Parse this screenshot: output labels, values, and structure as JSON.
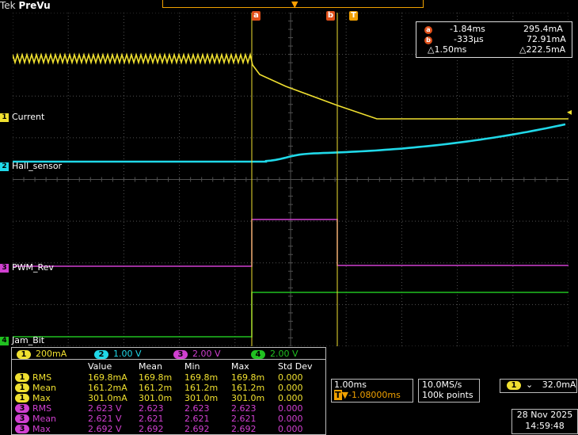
{
  "brand": {
    "tek": "Tek",
    "mode": "PreVu"
  },
  "colors": {
    "ch1": "#f0e030",
    "ch2": "#20d8e8",
    "ch3": "#d040d0",
    "ch4": "#20c020",
    "cursor": "#e0501a",
    "trigger": "#f0a000",
    "grid": "#505050"
  },
  "channels": [
    {
      "num": "1",
      "name": "Current"
    },
    {
      "num": "2",
      "name": "Hall_sensor"
    },
    {
      "num": "3",
      "name": "PWM_Rev"
    },
    {
      "num": "4",
      "name": "Jam_Bit"
    }
  ],
  "cursor_markers": {
    "a": "a",
    "b": "b",
    "t": "T"
  },
  "cursor_readout": {
    "a_time": "-1.84ms",
    "a_value": "295.4mA",
    "b_time": "-333µs",
    "b_value": "72.91mA",
    "delta_time": "△1.50ms",
    "delta_value": "△222.5mA"
  },
  "channel_scales": [
    {
      "num": "1",
      "scale": "200mA"
    },
    {
      "num": "2",
      "scale": "1.00 V"
    },
    {
      "num": "3",
      "scale": "2.00 V"
    },
    {
      "num": "4",
      "scale": "2.00 V"
    }
  ],
  "measurements": {
    "headers": [
      "Value",
      "Mean",
      "Min",
      "Max",
      "Std Dev"
    ],
    "rows": [
      {
        "ch": "1",
        "label": "RMS",
        "values": [
          "169.8mA",
          "169.8m",
          "169.8m",
          "169.8m",
          "0.000"
        ]
      },
      {
        "ch": "1",
        "label": "Mean",
        "values": [
          "161.2mA",
          "161.2m",
          "161.2m",
          "161.2m",
          "0.000"
        ]
      },
      {
        "ch": "1",
        "label": "Max",
        "values": [
          "301.0mA",
          "301.0m",
          "301.0m",
          "301.0m",
          "0.000"
        ]
      },
      {
        "ch": "3",
        "label": "RMS",
        "values": [
          "2.623 V",
          "2.623",
          "2.623",
          "2.623",
          "0.000"
        ]
      },
      {
        "ch": "3",
        "label": "Mean",
        "values": [
          "2.621 V",
          "2.621",
          "2.621",
          "2.621",
          "0.000"
        ]
      },
      {
        "ch": "3",
        "label": "Max",
        "values": [
          "2.692 V",
          "2.692",
          "2.692",
          "2.692",
          "0.000"
        ]
      }
    ]
  },
  "timebase": {
    "scale": "1.00ms",
    "delay": "▼-1.08000ms",
    "delay_icon": "T"
  },
  "acquisition": {
    "rate": "10.0MS/s",
    "points": "100k points"
  },
  "trigger": {
    "ch": "1",
    "slope": "⌄",
    "level": "32.0mA"
  },
  "datetime": {
    "date": "28 Nov 2025",
    "time": "14:59:48"
  }
}
